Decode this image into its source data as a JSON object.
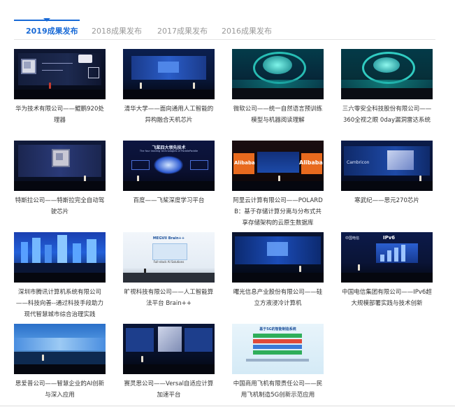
{
  "tabs": [
    {
      "label": "2019成果发布",
      "active": true
    },
    {
      "label": "2018成果发布",
      "active": false
    },
    {
      "label": "2017成果发布",
      "active": false
    },
    {
      "label": "2016成果发布",
      "active": false
    }
  ],
  "items": [
    {
      "caption": "华为技术有限公司——鲲鹏920处理器",
      "scene": "chip-stage"
    },
    {
      "caption": "清华大学——面向通用人工智能的异构融合天机芯片",
      "scene": "blue-stage"
    },
    {
      "caption": "微软公司——统一自然语言预训练模型与机器阅读理解",
      "scene": "teal-ring"
    },
    {
      "caption": "三六零安全科技股份有限公司——360全视之眼 0day漏洞雷达系统",
      "scene": "teal-ring"
    },
    {
      "caption": "特斯拉公司——特斯拉完全自动驾驶芯片",
      "scene": "chip-stage"
    },
    {
      "caption": "百度——飞桨深度学习平台",
      "scene": "paddle"
    },
    {
      "caption": "阿里云计算有限公司——POLARDB：基于存储计算分离与分布式共享存储架构的云原生数据库",
      "scene": "alibaba"
    },
    {
      "caption": "寒武纪——思元270芯片",
      "scene": "chip-stage"
    },
    {
      "caption": "深圳市腾讯计算机系统有限公司——科技向善--通过科技手段助力现代智慧城市综合治理实践",
      "scene": "city"
    },
    {
      "caption": "旷视科技有限公司——人工智能算法平台 Brain++",
      "scene": "bright"
    },
    {
      "caption": "曙光信息产业股份有限公司——硅立方液浸冷计算机",
      "scene": "blue-stage"
    },
    {
      "caption": "中国电信集团有限公司——IPv6超大规模部署实践与技术创新",
      "scene": "telecom"
    },
    {
      "caption": "思爱普公司——智慧企业的AI创新与深入应用",
      "scene": "city"
    },
    {
      "caption": "赛灵思公司——Versal自适应计算加速平台",
      "scene": "blue-stage"
    },
    {
      "caption": "中国商用飞机有限责任公司——民用飞机制造5G创新示范应用",
      "scene": "comac"
    }
  ],
  "screen_text": {
    "paddle_title": "飞桨四大领先技术",
    "paddle_sub": "The four leading technologies of PaddlePaddle",
    "ali_left": "Alibaba",
    "ali_right": "Alibaba",
    "cambricon": "Cambricon",
    "megvii": "MEGVII Brain++",
    "megvii_sub": "Full-stack AI Solutions",
    "telecom_brand": "中国电信",
    "telecom_ipv6": "IPv6",
    "comac_title": "基于5G的智能制造系统"
  },
  "colors": {
    "accent": "#1769d6",
    "tab_inactive": "#999999",
    "caption": "#333333"
  }
}
